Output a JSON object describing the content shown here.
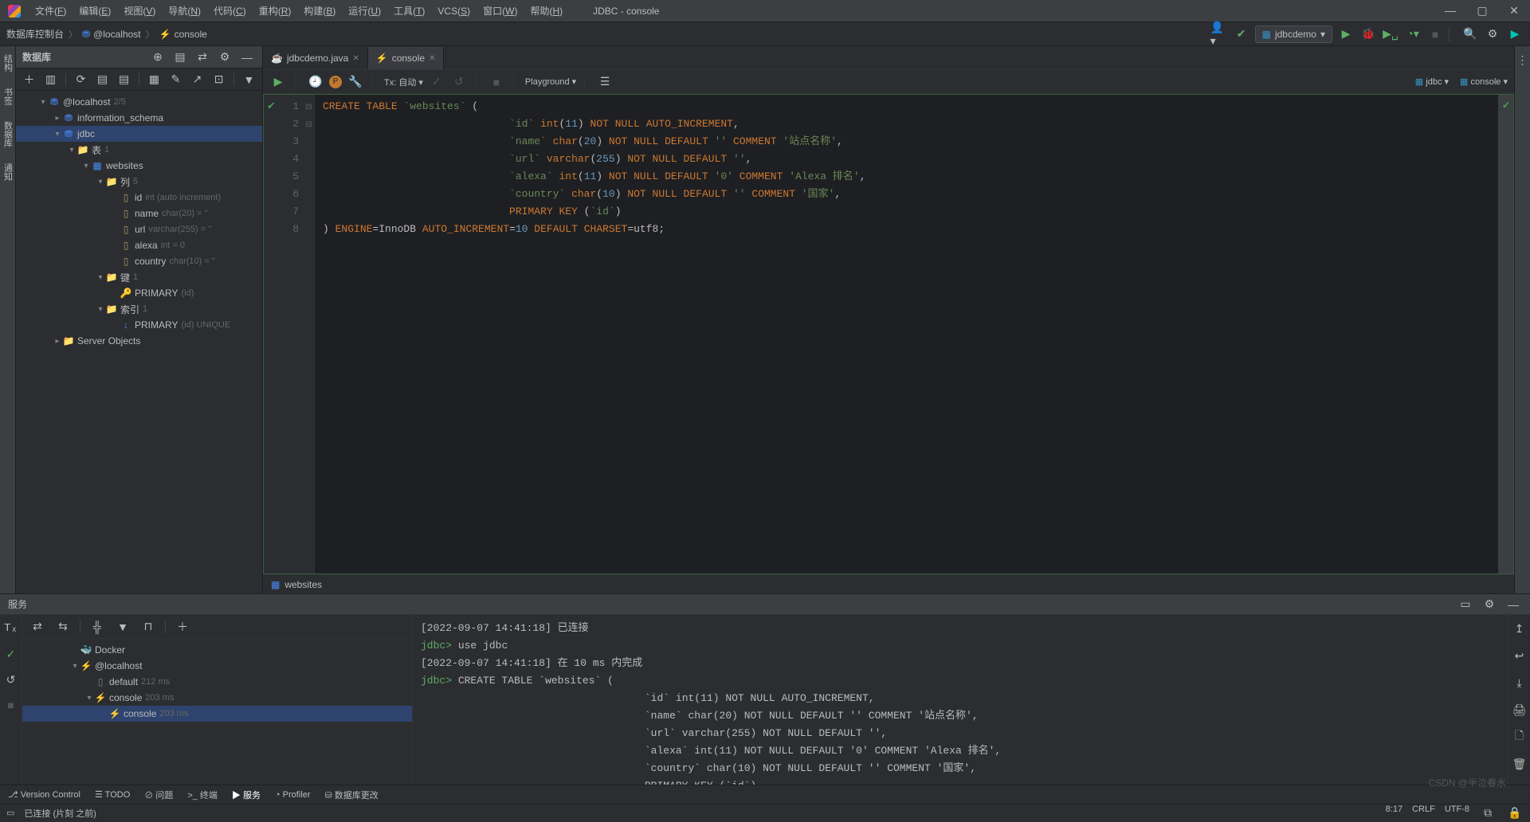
{
  "menu": [
    "文件(F)",
    "编辑(E)",
    "视图(V)",
    "导航(N)",
    "代码(C)",
    "重构(R)",
    "构建(B)",
    "运行(U)",
    "工具(T)",
    "VCS(S)",
    "窗口(W)",
    "帮助(H)"
  ],
  "window_title": "JDBC - console",
  "breadcrumb": [
    "数据库控制台",
    "@localhost",
    "console"
  ],
  "run_config": "jdbcdemo",
  "left_stripe": [
    "结构",
    "书签",
    "数据库",
    "通知"
  ],
  "db_panel": {
    "title": "数据库",
    "host": "@localhost",
    "host_hint": "2/5",
    "tree": [
      {
        "pad": 28,
        "arrow": "▾",
        "icon": "⛃",
        "iconcls": "db-icon",
        "label": "@localhost",
        "hint": "2/5"
      },
      {
        "pad": 46,
        "arrow": "▸",
        "icon": "⛃",
        "iconcls": "db-icon",
        "label": "information_schema"
      },
      {
        "pad": 46,
        "arrow": "▾",
        "icon": "⛃",
        "iconcls": "db-icon",
        "label": "jdbc",
        "sel": true
      },
      {
        "pad": 64,
        "arrow": "▾",
        "icon": "📁",
        "iconcls": "folder-icon",
        "label": "表",
        "hint": "1"
      },
      {
        "pad": 82,
        "arrow": "▾",
        "icon": "▦",
        "iconcls": "table-icon",
        "label": "websites"
      },
      {
        "pad": 100,
        "arrow": "▾",
        "icon": "📁",
        "iconcls": "folder-icon",
        "label": "列",
        "hint": "5"
      },
      {
        "pad": 118,
        "arrow": "",
        "icon": "▯",
        "iconcls": "col-icon",
        "label": "id",
        "hint": "int (auto increment)"
      },
      {
        "pad": 118,
        "arrow": "",
        "icon": "▯",
        "iconcls": "col-icon",
        "label": "name",
        "hint": "char(20) = ''"
      },
      {
        "pad": 118,
        "arrow": "",
        "icon": "▯",
        "iconcls": "col-icon",
        "label": "url",
        "hint": "varchar(255) = ''"
      },
      {
        "pad": 118,
        "arrow": "",
        "icon": "▯",
        "iconcls": "col-icon",
        "label": "alexa",
        "hint": "int = 0"
      },
      {
        "pad": 118,
        "arrow": "",
        "icon": "▯",
        "iconcls": "col-icon",
        "label": "country",
        "hint": "char(10) = ''"
      },
      {
        "pad": 100,
        "arrow": "▾",
        "icon": "📁",
        "iconcls": "folder-icon",
        "label": "键",
        "hint": "1"
      },
      {
        "pad": 118,
        "arrow": "",
        "icon": "🔑",
        "iconcls": "key-icon",
        "label": "PRIMARY",
        "hint": "(id)"
      },
      {
        "pad": 100,
        "arrow": "▾",
        "icon": "📁",
        "iconcls": "folder-icon",
        "label": "索引",
        "hint": "1"
      },
      {
        "pad": 118,
        "arrow": "",
        "icon": "↓",
        "iconcls": "idx-icon",
        "label": "PRIMARY",
        "hint": "(id) UNIQUE"
      },
      {
        "pad": 46,
        "arrow": "▸",
        "icon": "📁",
        "iconcls": "folder-icon",
        "label": "Server Objects"
      }
    ]
  },
  "tabs": [
    {
      "icon": "☕",
      "label": "jdbcdemo.java",
      "active": false
    },
    {
      "icon": "⚡",
      "label": "console",
      "active": true
    }
  ],
  "code_toolbar": {
    "tx": "Tx: 自动",
    "playground": "Playground",
    "jdbc": "jdbc",
    "console": "console"
  },
  "code_lines": [
    "<span class='kw'>CREATE TABLE</span> <span class='str'>`websites`</span> (",
    "                              <span class='str'>`id`</span> <span class='kw'>int</span>(<span class='num'>11</span>) <span class='kw'>NOT NULL</span> <span class='kw'>AUTO_INCREMENT</span>,",
    "                              <span class='str'>`name`</span> <span class='kw'>char</span>(<span class='num'>20</span>) <span class='kw'>NOT NULL DEFAULT</span> <span class='str'>''</span> <span class='kw'>COMMENT</span> <span class='str'>'站点名称'</span>,",
    "                              <span class='str'>`url`</span> <span class='kw'>varchar</span>(<span class='num'>255</span>) <span class='kw'>NOT NULL DEFAULT</span> <span class='str'>''</span>,",
    "                              <span class='str'>`alexa`</span> <span class='kw'>int</span>(<span class='num'>11</span>) <span class='kw'>NOT NULL DEFAULT</span> <span class='str'>'0'</span> <span class='kw'>COMMENT</span> <span class='str'>'Alexa 排名'</span>,",
    "                              <span class='str'>`country`</span> <span class='kw'>char</span>(<span class='num'>10</span>) <span class='kw'>NOT NULL DEFAULT</span> <span class='str'>''</span> <span class='kw'>COMMENT</span> <span class='str'>'国家'</span>,",
    "                              <span class='kw'>PRIMARY KEY</span> (<span class='str'>`id`</span>)",
    ") <span class='kw'>ENGINE</span>=InnoDB <span class='kw'>AUTO_INCREMENT</span>=<span class='num'>10</span> <span class='kw'>DEFAULT</span> <span class='kw'>CHARSET</span>=utf8;"
  ],
  "editor_breadcrumb": "websites",
  "services": {
    "title": "服务",
    "svc_tree": [
      {
        "pad": 10,
        "arrow": "",
        "icon": "🐳",
        "iconcls": "blue",
        "label": "Docker"
      },
      {
        "pad": 10,
        "arrow": "▾",
        "icon": "⚡",
        "iconcls": "blue",
        "label": "@localhost"
      },
      {
        "pad": 28,
        "arrow": "",
        "icon": "▯",
        "iconcls": "gray",
        "label": "default",
        "hint": "212 ms"
      },
      {
        "pad": 28,
        "arrow": "▾",
        "icon": "⚡",
        "iconcls": "blue",
        "label": "console",
        "hint": "203 ms"
      },
      {
        "pad": 46,
        "arrow": "",
        "icon": "⚡",
        "iconcls": "blue",
        "label": "console",
        "hint": "203 ms",
        "sel": true
      }
    ],
    "output": [
      "[2022-09-07 14:41:18] 已连接",
      "<span class='green'>jdbc&gt;</span> <span class='kw'>use</span> jdbc",
      "[2022-09-07 14:41:18] 在 10 ms 内完成",
      "<span class='green'>jdbc&gt;</span> <span class='kw'>CREATE TABLE</span> <span class='str'>`websites`</span> (",
      "                                    <span class='str'>`id`</span> <span class='kw'>int</span>(<span class='num'>11</span>) <span class='kw'>NOT NULL</span> <span class='kw'>AUTO_INCREMENT</span>,",
      "                                    <span class='str'>`name`</span> <span class='kw'>char</span>(<span class='num'>20</span>) <span class='kw'>NOT NULL DEFAULT</span> <span class='str'>''</span> <span class='kw'>COMMENT</span> <span class='str'>'站点名称'</span>,",
      "                                    <span class='str'>`url`</span> <span class='kw'>varchar</span>(<span class='num'>255</span>) <span class='kw'>NOT NULL DEFAULT</span> <span class='str'>''</span>,",
      "                                    <span class='str'>`alexa`</span> <span class='kw'>int</span>(<span class='num'>11</span>) <span class='kw'>NOT NULL DEFAULT</span> <span class='str'>'0'</span> <span class='kw'>COMMENT</span> <span class='str'>'Alexa 排名'</span>,",
      "                                    <span class='str'>`country`</span> <span class='kw'>char</span>(<span class='num'>10</span>) <span class='kw'>NOT NULL DEFAULT</span> <span class='str'>''</span> <span class='kw'>COMMENT</span> <span class='str'>'国家'</span>,",
      "                                    <span class='kw'>PRIMARY KEY</span> (<span class='str'>`id`</span>)"
    ]
  },
  "bottom_tools": [
    "Version Control",
    "TODO",
    "问题",
    "终端",
    "服务",
    "Profiler",
    "数据库更改"
  ],
  "status": {
    "left": "已连接 (片刻 之前)",
    "caret": "8:17",
    "crlf": "CRLF",
    "enc": "UTF-8"
  },
  "watermark": "CSDN @半泣春水"
}
